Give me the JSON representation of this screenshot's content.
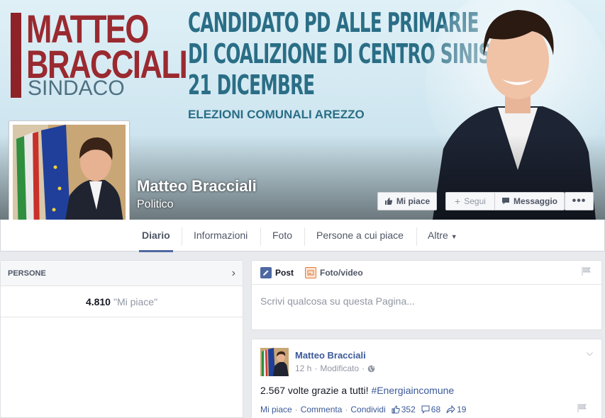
{
  "cover": {
    "logo": [
      "MATTEO",
      "BRACCIALI",
      "SINDACO"
    ],
    "headline": [
      "CANDIDATO PD ALLE PRIMARIE",
      "DI COALIZIONE DI CENTRO SINISTRA",
      "21 DICEMBRE"
    ],
    "subheadline": "ELEZIONI COMUNALI AREZZO"
  },
  "page": {
    "name": "Matteo Bracciali",
    "category": "Politico"
  },
  "actions": {
    "like": "Mi piace",
    "follow": "Segui",
    "message": "Messaggio",
    "more": "•••"
  },
  "tabs": [
    {
      "label": "Diario",
      "active": true
    },
    {
      "label": "Informazioni"
    },
    {
      "label": "Foto"
    },
    {
      "label": "Persone a cui piace"
    },
    {
      "label": "Altre"
    }
  ],
  "people": {
    "title": "PERSONE",
    "likes_count": "4.810",
    "likes_label": "\"Mi piace\""
  },
  "composer": {
    "tab_post": "Post",
    "tab_photo": "Foto/video",
    "placeholder": "Scrivi qualcosa su questa Pagina..."
  },
  "post": {
    "author": "Matteo Bracciali",
    "time": "12 h",
    "edited": "Modificato",
    "text": "2.567 volte grazie a tutti!",
    "hashtag": "#Energiaincomune",
    "like": "Mi piace",
    "comment": "Commenta",
    "share": "Condividi",
    "likes": "352",
    "comments": "68",
    "shares": "19"
  },
  "colors": {
    "brand_red": "#9a2a30",
    "headline_teal": "#2a6e86",
    "facebook_blue": "#3b5998"
  }
}
